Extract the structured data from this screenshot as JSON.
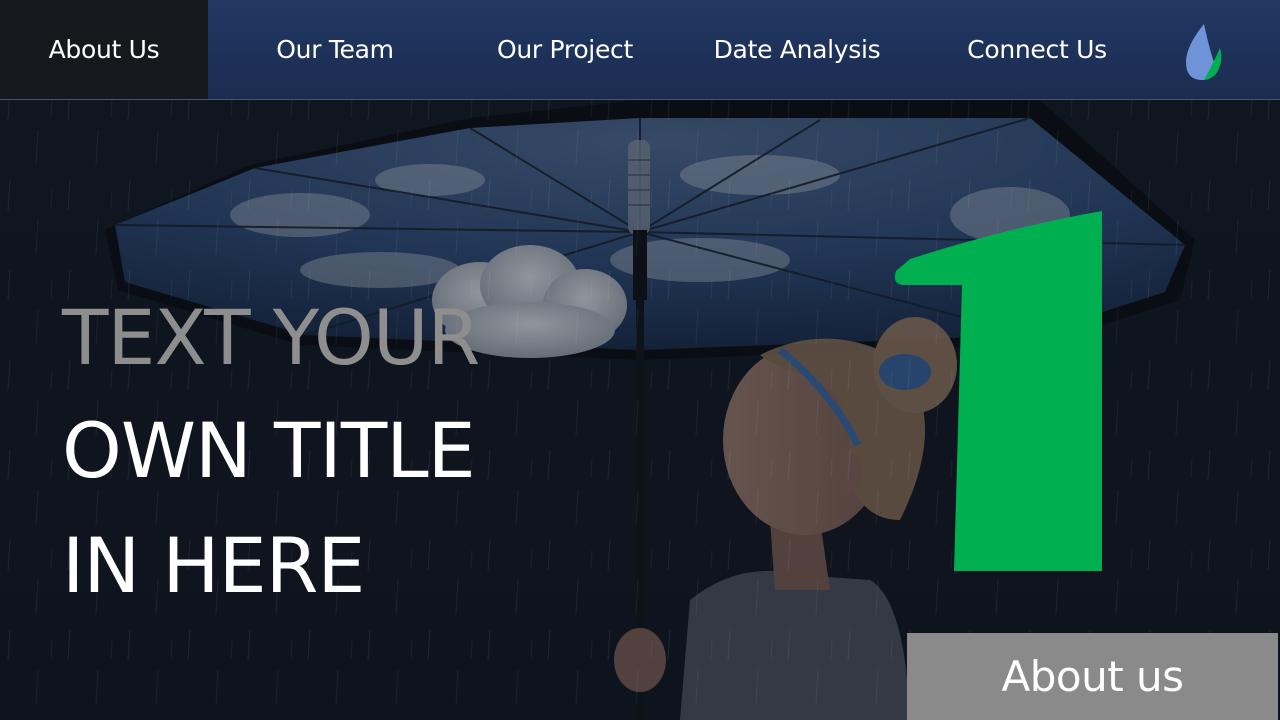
{
  "nav": {
    "items": [
      {
        "label": "About Us",
        "active": true
      },
      {
        "label": "Our Team"
      },
      {
        "label": "Our Project"
      },
      {
        "label": "Date Analysis"
      },
      {
        "label": "Connect Us"
      }
    ],
    "logo_icon": "flame-drop-icon"
  },
  "hero": {
    "title_lines": [
      "TEXT YOUR",
      "OWN TITLE",
      "IN HERE"
    ],
    "big_number": "1",
    "badge_label": "About us",
    "background_image": "girl-with-cloud-umbrella-in-rain"
  },
  "colors": {
    "nav_background": "#1f3460",
    "nav_active": "#17181d",
    "accent_green": "#00b050",
    "title_dim": "#8e8e8e",
    "badge_background": "#8a8a8a",
    "logo_blue": "#6f93d8"
  }
}
